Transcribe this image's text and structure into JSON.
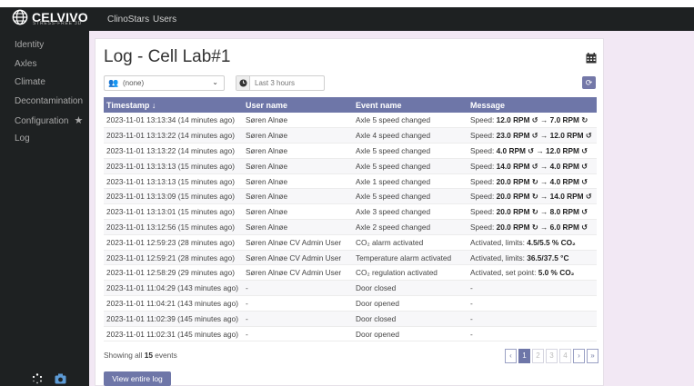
{
  "app": {
    "brand": "CELVIVO",
    "brand_sub": "STRESS-FREE 3D",
    "topnav": [
      "ClinoStars",
      "Users"
    ]
  },
  "sidebar": {
    "items": [
      {
        "label": "Identity"
      },
      {
        "label": "Axles"
      },
      {
        "label": "Climate"
      },
      {
        "label": "Decontamination"
      },
      {
        "label": "Configuration"
      },
      {
        "label": "Log"
      }
    ],
    "bottom_icons": [
      "loading-icon",
      "camera-icon"
    ]
  },
  "page": {
    "title": "Log - Cell Lab#1",
    "filter_select": "(none)",
    "time_filter_placeholder": "Last 3 hours"
  },
  "table": {
    "columns": [
      "Timestamp",
      "User name",
      "Event name",
      "Message"
    ],
    "rows": [
      {
        "ts": "2023-11-01 13:13:34 (14 minutes ago)",
        "user": "Søren Alnøe",
        "event": "Axle 5 speed changed",
        "msg_prefix": "Speed: ",
        "msg_bold": "12.0 RPM ↺ → 7.0 RPM ↻"
      },
      {
        "ts": "2023-11-01 13:13:22 (14 minutes ago)",
        "user": "Søren Alnøe",
        "event": "Axle 4 speed changed",
        "msg_prefix": "Speed: ",
        "msg_bold": "23.0 RPM ↺ → 12.0 RPM ↺"
      },
      {
        "ts": "2023-11-01 13:13:22 (14 minutes ago)",
        "user": "Søren Alnøe",
        "event": "Axle 5 speed changed",
        "msg_prefix": "Speed: ",
        "msg_bold": "4.0 RPM ↺ → 12.0 RPM ↺"
      },
      {
        "ts": "2023-11-01 13:13:13 (15 minutes ago)",
        "user": "Søren Alnøe",
        "event": "Axle 5 speed changed",
        "msg_prefix": "Speed: ",
        "msg_bold": "14.0 RPM ↺ → 4.0 RPM ↺"
      },
      {
        "ts": "2023-11-01 13:13:13 (15 minutes ago)",
        "user": "Søren Alnøe",
        "event": "Axle 1 speed changed",
        "msg_prefix": "Speed: ",
        "msg_bold": "20.0 RPM ↻ → 4.0 RPM ↺"
      },
      {
        "ts": "2023-11-01 13:13:09 (15 minutes ago)",
        "user": "Søren Alnøe",
        "event": "Axle 5 speed changed",
        "msg_prefix": "Speed: ",
        "msg_bold": "20.0 RPM ↻ → 14.0 RPM ↺"
      },
      {
        "ts": "2023-11-01 13:13:01 (15 minutes ago)",
        "user": "Søren Alnøe",
        "event": "Axle 3 speed changed",
        "msg_prefix": "Speed: ",
        "msg_bold": "20.0 RPM ↻ → 8.0 RPM ↺"
      },
      {
        "ts": "2023-11-01 13:12:56 (15 minutes ago)",
        "user": "Søren Alnøe",
        "event": "Axle 2 speed changed",
        "msg_prefix": "Speed: ",
        "msg_bold": "20.0 RPM ↻ → 6.0 RPM ↺"
      },
      {
        "ts": "2023-11-01 12:59:23 (28 minutes ago)",
        "user": "Søren Alnøe CV Admin User",
        "event": "CO₂ alarm activated",
        "msg_prefix": "Activated, limits: ",
        "msg_bold": "4.5/5.5 % CO₂"
      },
      {
        "ts": "2023-11-01 12:59:21 (28 minutes ago)",
        "user": "Søren Alnøe CV Admin User",
        "event": "Temperature alarm activated",
        "msg_prefix": "Activated, limits: ",
        "msg_bold": "36.5/37.5 °C"
      },
      {
        "ts": "2023-11-01 12:58:29 (29 minutes ago)",
        "user": "Søren Alnøe CV Admin User",
        "event": "CO₂ regulation activated",
        "msg_prefix": "Activated, set point: ",
        "msg_bold": "5.0 % CO₂"
      },
      {
        "ts": "2023-11-01 11:04:29 (143 minutes ago)",
        "user": "-",
        "event": "Door closed",
        "msg_prefix": "-",
        "msg_bold": ""
      },
      {
        "ts": "2023-11-01 11:04:21 (143 minutes ago)",
        "user": "-",
        "event": "Door opened",
        "msg_prefix": "-",
        "msg_bold": ""
      },
      {
        "ts": "2023-11-01 11:02:39 (145 minutes ago)",
        "user": "-",
        "event": "Door closed",
        "msg_prefix": "-",
        "msg_bold": ""
      },
      {
        "ts": "2023-11-01 11:02:31 (145 minutes ago)",
        "user": "-",
        "event": "Door opened",
        "msg_prefix": "-",
        "msg_bold": ""
      }
    ]
  },
  "footer": {
    "showing_prefix": "Showing all",
    "count": "15",
    "showing_suffix": "events",
    "pager": [
      "‹",
      "1",
      "2",
      "3",
      "4",
      "›",
      "»"
    ],
    "view_button": "View entire log"
  },
  "colors": {
    "accent": "#6e76a8",
    "sidebar_bg": "#1e2122",
    "page_bg": "#f2e8f4"
  }
}
